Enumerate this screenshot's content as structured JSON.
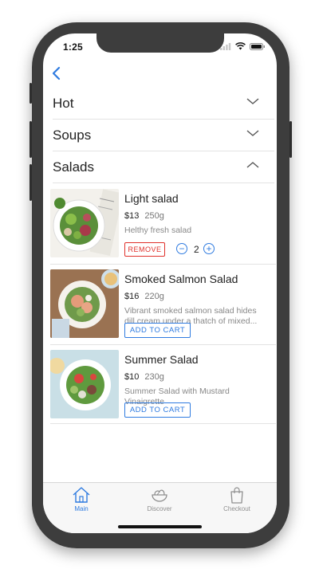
{
  "status_bar": {
    "time": "1:25"
  },
  "categories": [
    {
      "label": "Hot",
      "expanded": false
    },
    {
      "label": "Soups",
      "expanded": false
    },
    {
      "label": "Salads",
      "expanded": true
    }
  ],
  "products": [
    {
      "name": "Light salad",
      "price": "$13",
      "weight": "250g",
      "description": "Helthy fresh salad",
      "in_cart": true,
      "remove_label": "REMOVE",
      "quantity": "2",
      "decrement_symbol": "−",
      "increment_symbol": "+"
    },
    {
      "name": "Smoked Salmon Salad",
      "price": "$16",
      "weight": "220g",
      "description": "Vibrant smoked salmon salad hides dill cream under a thatch of mixed...",
      "in_cart": false,
      "add_label": "ADD TO CART"
    },
    {
      "name": "Summer Salad",
      "price": "$10",
      "weight": "230g",
      "description": "Summer Salad with Mustard Vinaigrette",
      "in_cart": false,
      "add_label": "ADD TO CART"
    }
  ],
  "tab_bar": {
    "tabs": [
      {
        "label": "Main",
        "icon": "home-icon",
        "active": true
      },
      {
        "label": "Discover",
        "icon": "salad-bowl-icon",
        "active": false
      },
      {
        "label": "Checkout",
        "icon": "shopping-bag-icon",
        "active": false
      }
    ]
  },
  "colors": {
    "accent": "#2f7be0",
    "danger": "#e0302a",
    "inactive_tab": "#8e8e8e",
    "frame": "#3d3d3d"
  }
}
